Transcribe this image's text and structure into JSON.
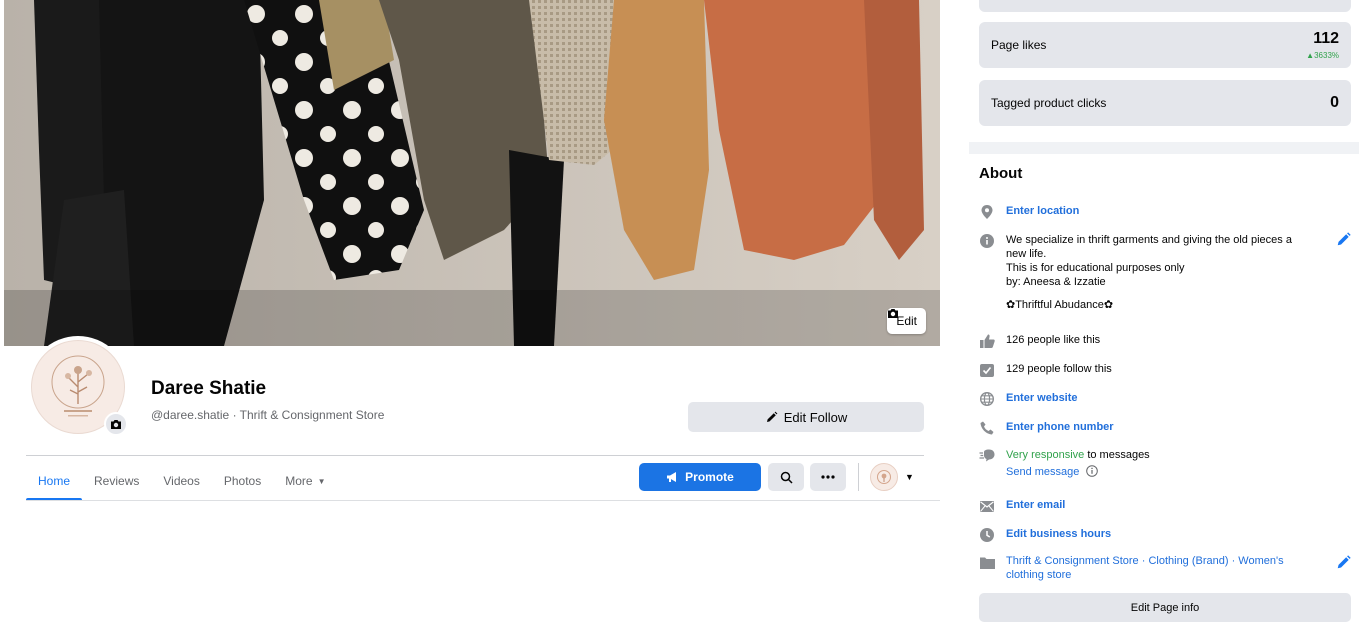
{
  "cover": {
    "edit_label": "Edit"
  },
  "profile": {
    "name": "Daree Shatie",
    "subtitle": "@daree.shatie · Thrift & Consignment Store",
    "edit_follow_label": "Edit Follow"
  },
  "tabs": [
    {
      "label": "Home",
      "active": true
    },
    {
      "label": "Reviews"
    },
    {
      "label": "Videos"
    },
    {
      "label": "Photos"
    },
    {
      "label": "More"
    }
  ],
  "actions": {
    "promote_label": "Promote"
  },
  "stats": [
    {
      "label": "Page likes",
      "value": "112",
      "delta": "▲3633%"
    },
    {
      "label": "Tagged product clicks",
      "value": "0"
    }
  ],
  "about": {
    "title": "About",
    "location": "Enter location",
    "description_lines": [
      "We specialize in thrift garments and giving the old pieces a",
      "new life.",
      "This is for educational purposes only",
      "by: Aneesa & Izzatie"
    ],
    "brand_line": "✿Thriftful Abudance✿",
    "likes_text": "126 people like this",
    "follows_text": "129 people follow this",
    "website": "Enter website",
    "phone": "Enter phone number",
    "responsive_highlight": "Very responsive",
    "responsive_rest": " to messages",
    "send_message": "Send message",
    "email": "Enter email",
    "hours": "Edit business hours",
    "category_line1": "Thrift & Consignment Store · Clothing (Brand) · Women's",
    "category_line2": "clothing store",
    "edit_info_label": "Edit Page info"
  },
  "colors": {
    "accent": "#1877f2",
    "positive": "#31a24c",
    "button_gray": "#e4e6eb",
    "link": "#216fdb"
  }
}
